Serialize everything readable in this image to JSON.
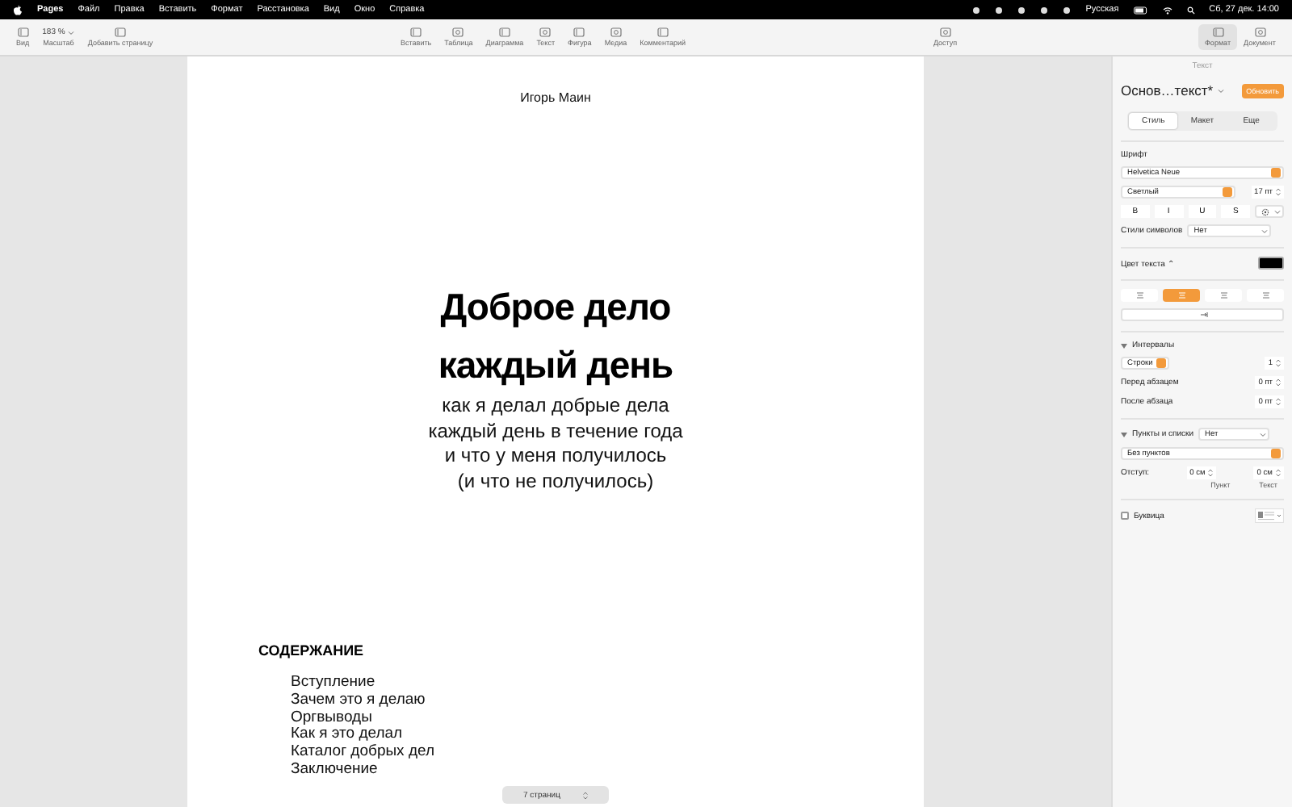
{
  "menu_bar": {
    "items": [
      "Pages",
      "Файл",
      "Правка",
      "Вставить",
      "Формат",
      "Расстановка",
      "Вид",
      "Окно",
      "Справка"
    ],
    "keyboard": "Русская",
    "clock": "Сб, 27 дек. 14:00"
  },
  "toolbar": {
    "left": [
      {
        "label": "Вид"
      },
      {
        "label": "Масштаб",
        "value": "183 %"
      },
      {
        "label": "Добавить страницу"
      }
    ],
    "center": [
      {
        "label": "Вставить"
      },
      {
        "label": "Таблица"
      },
      {
        "label": "Диаграмма"
      },
      {
        "label": "Текст"
      },
      {
        "label": "Фигура"
      },
      {
        "label": "Медиа"
      },
      {
        "label": "Комментарий"
      }
    ],
    "share": {
      "label": "Доступ"
    },
    "right": [
      {
        "label": "Формат",
        "selected": true
      },
      {
        "label": "Документ",
        "selected": false
      }
    ]
  },
  "document": {
    "author": "Игорь Маин",
    "title": [
      "Доброе дело",
      "каждый день"
    ],
    "subtitle": [
      "как я делал добрые дела",
      "каждый день в течение года",
      "и что у меня получилось",
      "(и что не получилось)"
    ],
    "toc_heading": "СОДЕРЖАНИЕ",
    "toc": [
      "Вступление",
      "Зачем это я делаю",
      "Оргвыводы",
      "Как я это делал",
      "Каталог добрых дел",
      "Заключение"
    ],
    "page_count": "7 страниц"
  },
  "sidebar": {
    "header": "Текст",
    "style_name": "Основ…текст*",
    "update_button": "Обновить",
    "tabs": [
      {
        "label": "Стиль",
        "selected": true
      },
      {
        "label": "Макет",
        "selected": false
      },
      {
        "label": "Еще",
        "selected": false
      }
    ],
    "font_label": "Шрифт",
    "font": "Helvetica Neue",
    "typeface": "Светлый",
    "size": "17 пт",
    "format_buttons": [
      "B",
      "I",
      "U",
      "S"
    ],
    "char_styles_label": "Стили символов",
    "char_styles": "Нет",
    "text_color_label": "Цвет текста ⌃",
    "alignment": [
      {
        "selected": false
      },
      {
        "selected": true
      },
      {
        "selected": false
      },
      {
        "selected": false
      }
    ],
    "spacing": {
      "label": "Интервалы",
      "expanded": true,
      "line_mode": "Строки",
      "line_value": "1",
      "before_label": "Перед абзацем",
      "before": "0 пт",
      "after_label": "После абзаца",
      "after": "0 пт"
    },
    "bullets": {
      "label": "Пункты и списки",
      "expanded": true,
      "value": "Нет",
      "type": "Без пунктов",
      "indent_label": "Отступ:",
      "bullet_indent": "0 см",
      "text_indent": "0 см",
      "bullet_caption": "Пункт",
      "text_caption": "Текст"
    },
    "dropcap": {
      "label": "Буквица",
      "checked": false
    }
  }
}
